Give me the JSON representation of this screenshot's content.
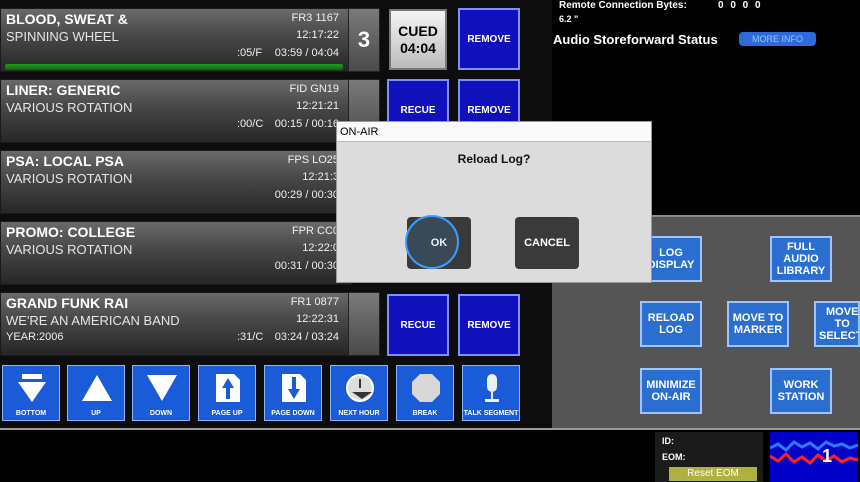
{
  "log": {
    "items": [
      {
        "title": "BLOOD, SWEAT &",
        "subtitle": "SPINNING WHEEL",
        "code": "FR3 1167",
        "time": "12:17:22",
        "etc": ":05/F",
        "duration": "03:59 / 04:04",
        "number": "3"
      },
      {
        "title": "LINER: GENERIC",
        "subtitle": "VARIOUS ROTATION",
        "code": "FID GN19",
        "time": "12:21:21",
        "etc": ":00/C",
        "duration": "00:15 / 00:16"
      },
      {
        "title": "PSA: LOCAL PSA",
        "subtitle": "VARIOUS ROTATION",
        "code": "FPS LO25",
        "time": "12:21:3",
        "duration": "00:29 / 00:30"
      },
      {
        "title": "PROMO: COLLEGE",
        "subtitle": "VARIOUS ROTATION",
        "code": "FPR CC0",
        "time": "12:22:0",
        "duration": "00:31 / 00:30"
      },
      {
        "title": "GRAND FUNK RAI",
        "subtitle": "WE'RE AN AMERICAN BAND",
        "code": "FR1 0877",
        "time": "12:22:31",
        "year": "YEAR:2006",
        "etc": ":31/C",
        "duration": "03:24 / 03:24"
      }
    ],
    "cued": {
      "label": "CUED",
      "time": "04:04"
    },
    "remove_label": "REMOVE",
    "recue_label": "RECUE"
  },
  "nav": {
    "bottom": "BOTTOM",
    "up": "UP",
    "down": "DOWN",
    "page_up": "PAGE UP",
    "page_down": "PAGE DOWN",
    "next_hour": "NEXT HOUR",
    "break": "BREAK",
    "talk_segment": "TALK SEGMENT"
  },
  "status": {
    "remote_label": "Remote Connection Bytes:",
    "remote_value": "0 0 0 0",
    "remote_sub": "6.2 \"",
    "storeforward_title": "Audio Storeforward Status",
    "more_info": "MORE INFO"
  },
  "actions": {
    "log_display": "LOG DISPLAY",
    "full_audio_library": "FULL AUDIO LIBRARY",
    "reload_log": "RELOAD LOG",
    "move_to_marker": "MOVE TO MARKER",
    "move_to_selection": "MOVE TO SELECTI",
    "minimize_on_air": "MINIMIZE ON-AIR",
    "work_station": "WORK STATION"
  },
  "dialog": {
    "title": "ON-AIR",
    "message": "Reload Log?",
    "ok": "OK",
    "cancel": "CANCEL"
  },
  "bottom": {
    "id_label": "ID:",
    "eom_label": "EOM:",
    "reset_eom": "Reset EOM",
    "meter_number": "1"
  }
}
